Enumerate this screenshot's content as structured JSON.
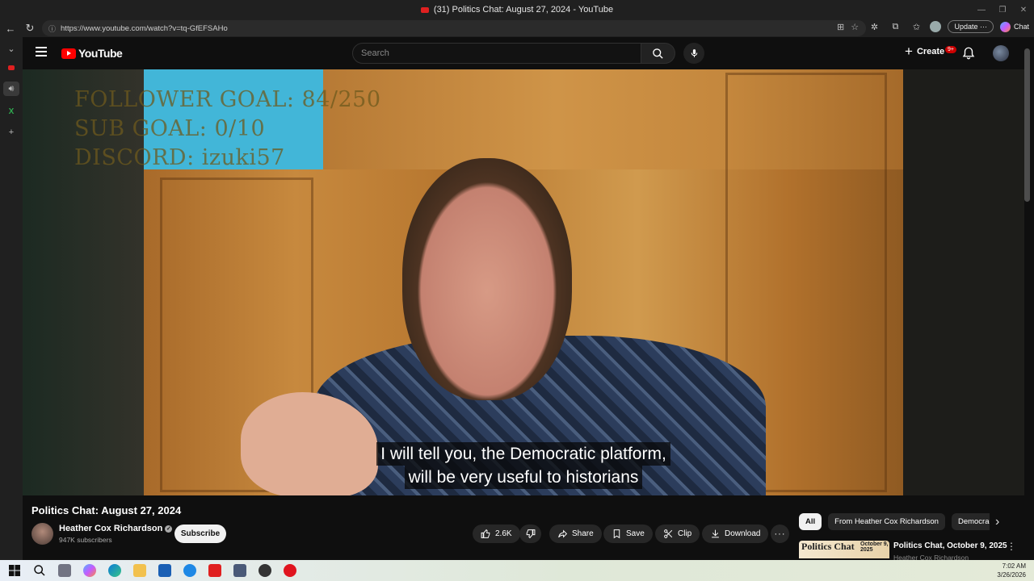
{
  "browser": {
    "tab_title": "(31) Politics Chat: August 27, 2024 - YouTube",
    "url": "https://www.youtube.com/watch?v=tq-GfEFSAHo",
    "update_label": "Update",
    "chat_label": "Chat"
  },
  "youtube": {
    "logo_text": "YouTube",
    "search_placeholder": "Search",
    "create_label": "Create",
    "notification_badge": "9+"
  },
  "video": {
    "overlay_lines": [
      "FOLLOWER GOAL:  84/250",
      "SUB GOAL: 0/10",
      "DISCORD: izuki57"
    ],
    "caption_lines": [
      "I will tell you, the Democratic platform,",
      "will be very useful to historians"
    ],
    "title": "Politics Chat: August 27, 2024",
    "channel_name": "Heather Cox Richardson",
    "subscribers": "947K subscribers",
    "subscribe_label": "Subscribe",
    "like_count": "2.6K",
    "share_label": "Share",
    "save_label": "Save",
    "clip_label": "Clip",
    "download_label": "Download"
  },
  "sidebar_right": {
    "chips": [
      "All",
      "From Heather Cox Richardson",
      "Democracy"
    ],
    "recommendation": {
      "thumb_text": "Politics Chat",
      "thumb_date": "October 9, 2025",
      "title": "Politics Chat, October 9, 2025",
      "channel": "Heather Cox Richardson"
    }
  },
  "taskbar": {
    "time": "7:02 AM",
    "date": "3/26/2026"
  },
  "colors": {
    "youtube_red": "#ff0000",
    "background": "#0f0f0f",
    "chip_bg": "#272727"
  }
}
